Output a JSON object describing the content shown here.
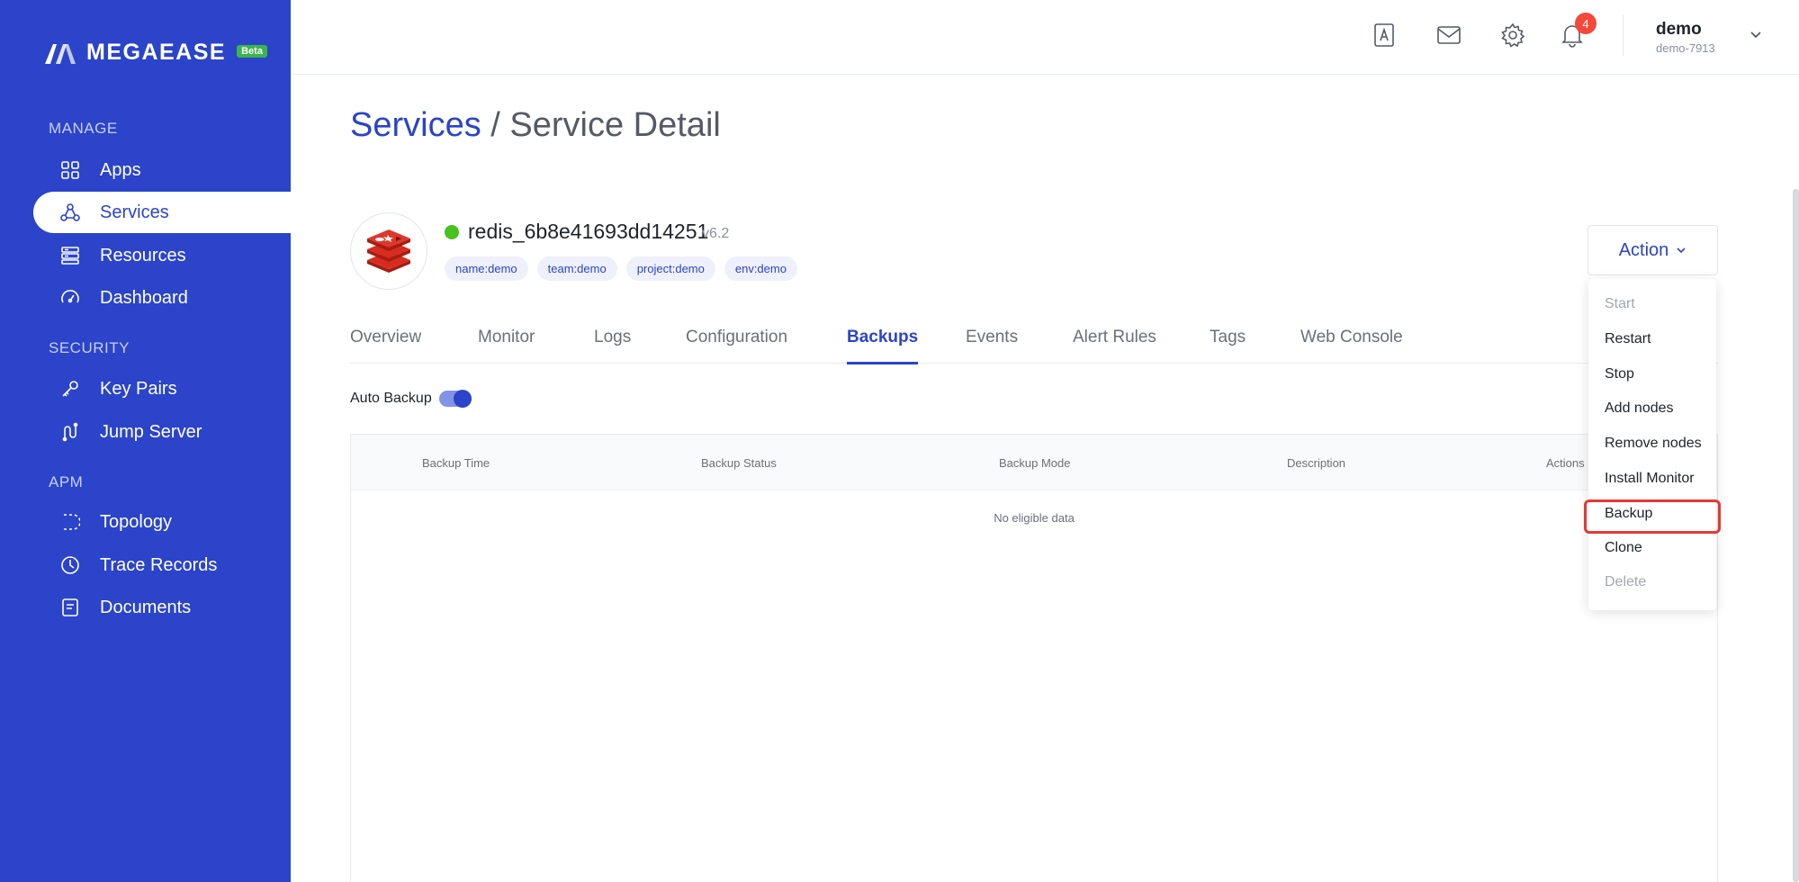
{
  "sidebar": {
    "brand": "MEGAEASE",
    "beta": "Beta",
    "sections": {
      "manage": "MANAGE",
      "security": "SECURITY",
      "apm": "APM"
    },
    "items": {
      "apps": "Apps",
      "services": "Services",
      "resources": "Resources",
      "dashboard": "Dashboard",
      "key_pairs": "Key Pairs",
      "jump_server": "Jump Server",
      "topology": "Topology",
      "trace_records": "Trace Records",
      "documents": "Documents"
    },
    "active_item": "services"
  },
  "header": {
    "notification_count": "4",
    "user_name": "demo",
    "user_id": "demo-7913"
  },
  "breadcrumb": {
    "parent": "Services",
    "separator": " / ",
    "current": "Service Detail"
  },
  "service": {
    "name": "redis_6b8e41693dd14251",
    "version": "v6.2",
    "status_color": "#47c21f",
    "tags": [
      "name:demo",
      "team:demo",
      "project:demo",
      "env:demo"
    ]
  },
  "tabs": {
    "overview": "Overview",
    "monitor": "Monitor",
    "logs": "Logs",
    "configuration": "Configuration",
    "backups": "Backups",
    "events": "Events",
    "alert_rules": "Alert Rules",
    "tags": "Tags",
    "web_console": "Web Console",
    "active": "backups"
  },
  "backups": {
    "auto_backup_label": "Auto Backup",
    "auto_backup_enabled": true,
    "columns": {
      "time": "Backup Time",
      "status": "Backup Status",
      "mode": "Backup Mode",
      "description": "Description",
      "actions": "Actions"
    },
    "empty_text": "No eligible data"
  },
  "action_menu": {
    "button_label": "Action",
    "items": {
      "start": "Start",
      "restart": "Restart",
      "stop": "Stop",
      "add_nodes": "Add nodes",
      "remove_nodes": "Remove nodes",
      "install_monitor": "Install Monitor",
      "backup": "Backup",
      "clone": "Clone",
      "delete": "Delete"
    },
    "highlighted": "backup"
  },
  "colors": {
    "brand": "#2b44c9",
    "highlight": "#e53935",
    "badge": "#f5483b"
  }
}
